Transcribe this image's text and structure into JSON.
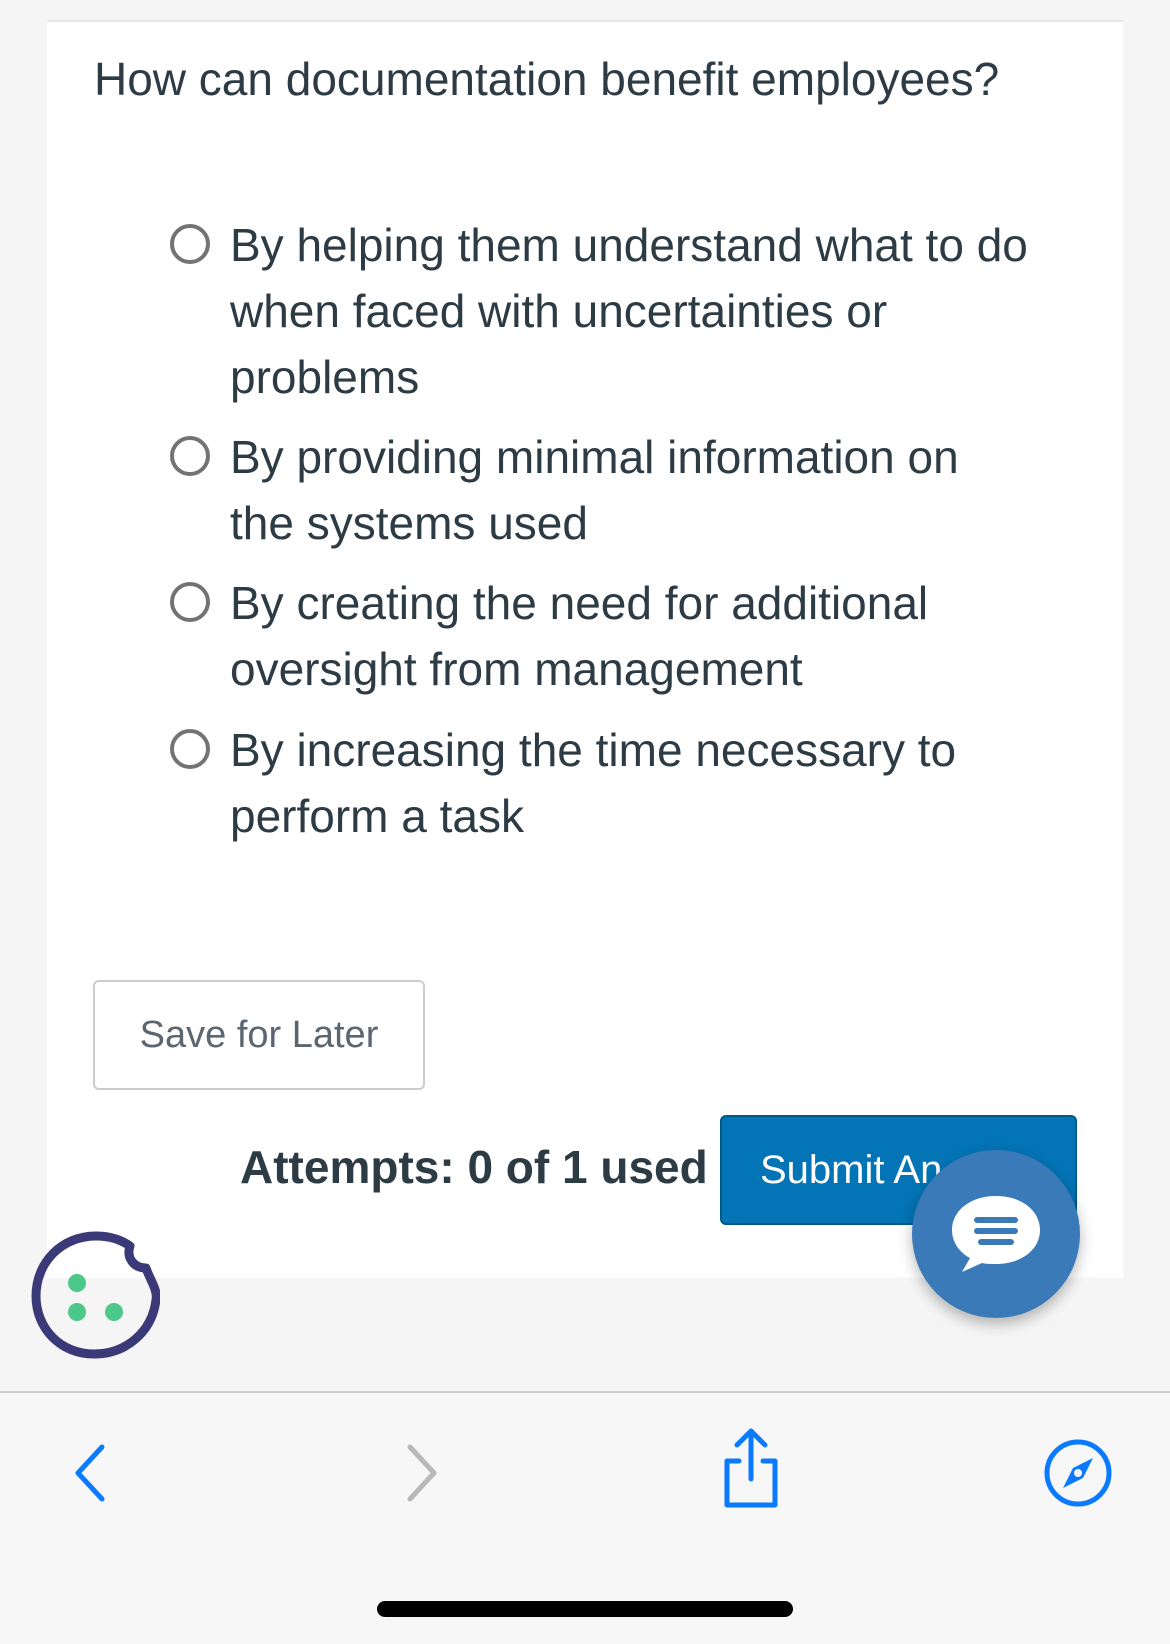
{
  "question": {
    "text": "How can documentation benefit employees?"
  },
  "options": [
    {
      "label": "By helping them understand what to do when faced with uncertainties or problems",
      "selected": false
    },
    {
      "label": "By providing minimal information on the systems used",
      "selected": false
    },
    {
      "label": "By creating the need for additional oversight from management",
      "selected": false
    },
    {
      "label": "By increasing the time necessary to perform a task",
      "selected": false
    }
  ],
  "actions": {
    "save_label": "Save for Later",
    "attempts_text": "Attempts: 0 of 1 used",
    "submit_label": "Submit An"
  },
  "icons": {
    "chat": "chat-bubble-icon",
    "cookie": "cookie-icon",
    "back": "chevron-left-icon",
    "forward": "chevron-right-icon",
    "share": "share-icon",
    "browser": "compass-icon"
  },
  "colors": {
    "submit": "#0374b5",
    "chat_button": "#3a7ab8",
    "toolbar_accent": "#0a7aff",
    "cookie_outline": "#3b3a78",
    "cookie_dots": "#4cc98a",
    "text": "#2d3b45"
  }
}
